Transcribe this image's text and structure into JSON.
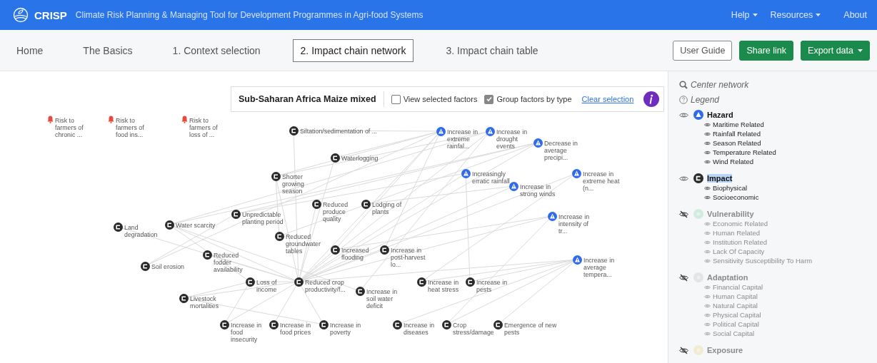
{
  "navbar": {
    "brand": "CRISP",
    "subtitle": "Climate Risk Planning & Managing Tool for Development Programmes in Agri-food Systems",
    "menu": [
      {
        "label": "Help",
        "dropdown": true
      },
      {
        "label": "Resources",
        "dropdown": true
      },
      {
        "label": "About",
        "dropdown": false
      }
    ]
  },
  "tabs": [
    {
      "label": "Home",
      "selected": false
    },
    {
      "label": "The Basics",
      "selected": false
    },
    {
      "label": "1. Context selection",
      "selected": false
    },
    {
      "label": "2. Impact chain network",
      "selected": true
    },
    {
      "label": "3. Impact chain table",
      "selected": false
    }
  ],
  "actions": [
    {
      "label": "User Guide",
      "kind": "outline",
      "dropdown": false
    },
    {
      "label": "Share link",
      "kind": "primary",
      "dropdown": false
    },
    {
      "label": "Export data",
      "kind": "primary",
      "dropdown": true
    }
  ],
  "toolbar": {
    "title": "Sub-Saharan Africa Maize mixed",
    "options": [
      {
        "label": "View selected factors",
        "checked": false
      },
      {
        "label": "Group factors by type",
        "checked": true
      }
    ],
    "link": "Clear selection"
  },
  "network": {
    "nodes": [
      {
        "label": "Risk to farmers of chronic ...",
        "kind": "risk"
      },
      {
        "label": "Risk to farmers of food ins...",
        "kind": "risk"
      },
      {
        "label": "Risk to farmers of loss of ...",
        "kind": "risk"
      },
      {
        "label": "Siltation/sedimentation of ...",
        "kind": "impact"
      },
      {
        "label": "Waterlogging",
        "kind": "impact"
      },
      {
        "label": "Shorter growing season",
        "kind": "impact"
      },
      {
        "label": "Reduced produce quality",
        "kind": "impact"
      },
      {
        "label": "Lodging of plants",
        "kind": "impact"
      },
      {
        "label": "Unpredictable planting period",
        "kind": "impact"
      },
      {
        "label": "Land degradation",
        "kind": "impact"
      },
      {
        "label": "Water scarcity",
        "kind": "impact"
      },
      {
        "label": "Reduced groundwater tables",
        "kind": "impact"
      },
      {
        "label": "Increased flooding",
        "kind": "impact"
      },
      {
        "label": "Increase in post-harvest lo...",
        "kind": "impact"
      },
      {
        "label": "Reduced fodder availability",
        "kind": "impact"
      },
      {
        "label": "Soil erosion",
        "kind": "impact"
      },
      {
        "label": "Loss of income",
        "kind": "impact"
      },
      {
        "label": "Reduced crop productivity/f...",
        "kind": "impact"
      },
      {
        "label": "Increase in soil water deficit",
        "kind": "impact"
      },
      {
        "label": "Increase in heat stress",
        "kind": "impact"
      },
      {
        "label": "Increase in pests",
        "kind": "impact"
      },
      {
        "label": "Livestock mortalities",
        "kind": "impact"
      },
      {
        "label": "Increase in food insecurity",
        "kind": "impact"
      },
      {
        "label": "Increase in food prices",
        "kind": "impact"
      },
      {
        "label": "Increase in poverty",
        "kind": "impact"
      },
      {
        "label": "Increase in diseases",
        "kind": "impact"
      },
      {
        "label": "Crop stress/damage",
        "kind": "impact"
      },
      {
        "label": "Emergence of new pests",
        "kind": "impact"
      },
      {
        "label": "Increase in extreme rainfal...",
        "kind": "hazard"
      },
      {
        "label": "Increase in drought events",
        "kind": "hazard"
      },
      {
        "label": "Decrease in average precipi...",
        "kind": "hazard"
      },
      {
        "label": "Increasingly erratic rainfall",
        "kind": "hazard"
      },
      {
        "label": "Increase in strong winds",
        "kind": "hazard"
      },
      {
        "label": "Increase in extreme heat (n...",
        "kind": "hazard"
      },
      {
        "label": "Increase in intensity of tr...",
        "kind": "hazard"
      },
      {
        "label": "Increase in average tempera...",
        "kind": "hazard"
      }
    ]
  },
  "sidebar": {
    "center": "Center network",
    "legend": "Legend",
    "groups": [
      {
        "label": "Hazard",
        "kind": "hazard",
        "visible": true,
        "text_selected": false,
        "items": [
          "Maritime Related",
          "Rainfall Related",
          "Season Related",
          "Temperature Related",
          "Wind Related"
        ]
      },
      {
        "label": "Impact",
        "kind": "impact",
        "visible": true,
        "text_selected": true,
        "items": [
          "Biophysical",
          "Socioeconomic"
        ]
      },
      {
        "label": "Vulnerability",
        "kind": "vulnerability",
        "visible": false,
        "text_selected": false,
        "items": [
          "Economic Related",
          "Human Related",
          "Institution Related",
          "Lack Of Capacity",
          "Sensitivity Susceptibility To Harm"
        ]
      },
      {
        "label": "Adaptation",
        "kind": "adaptation",
        "visible": false,
        "text_selected": false,
        "items": [
          "Financial Capital",
          "Human Capital",
          "Natural Capital",
          "Physical Capital",
          "Political Capital",
          "Social Capital"
        ]
      },
      {
        "label": "Exposure",
        "kind": "exposure",
        "visible": false,
        "text_selected": false
      }
    ]
  }
}
